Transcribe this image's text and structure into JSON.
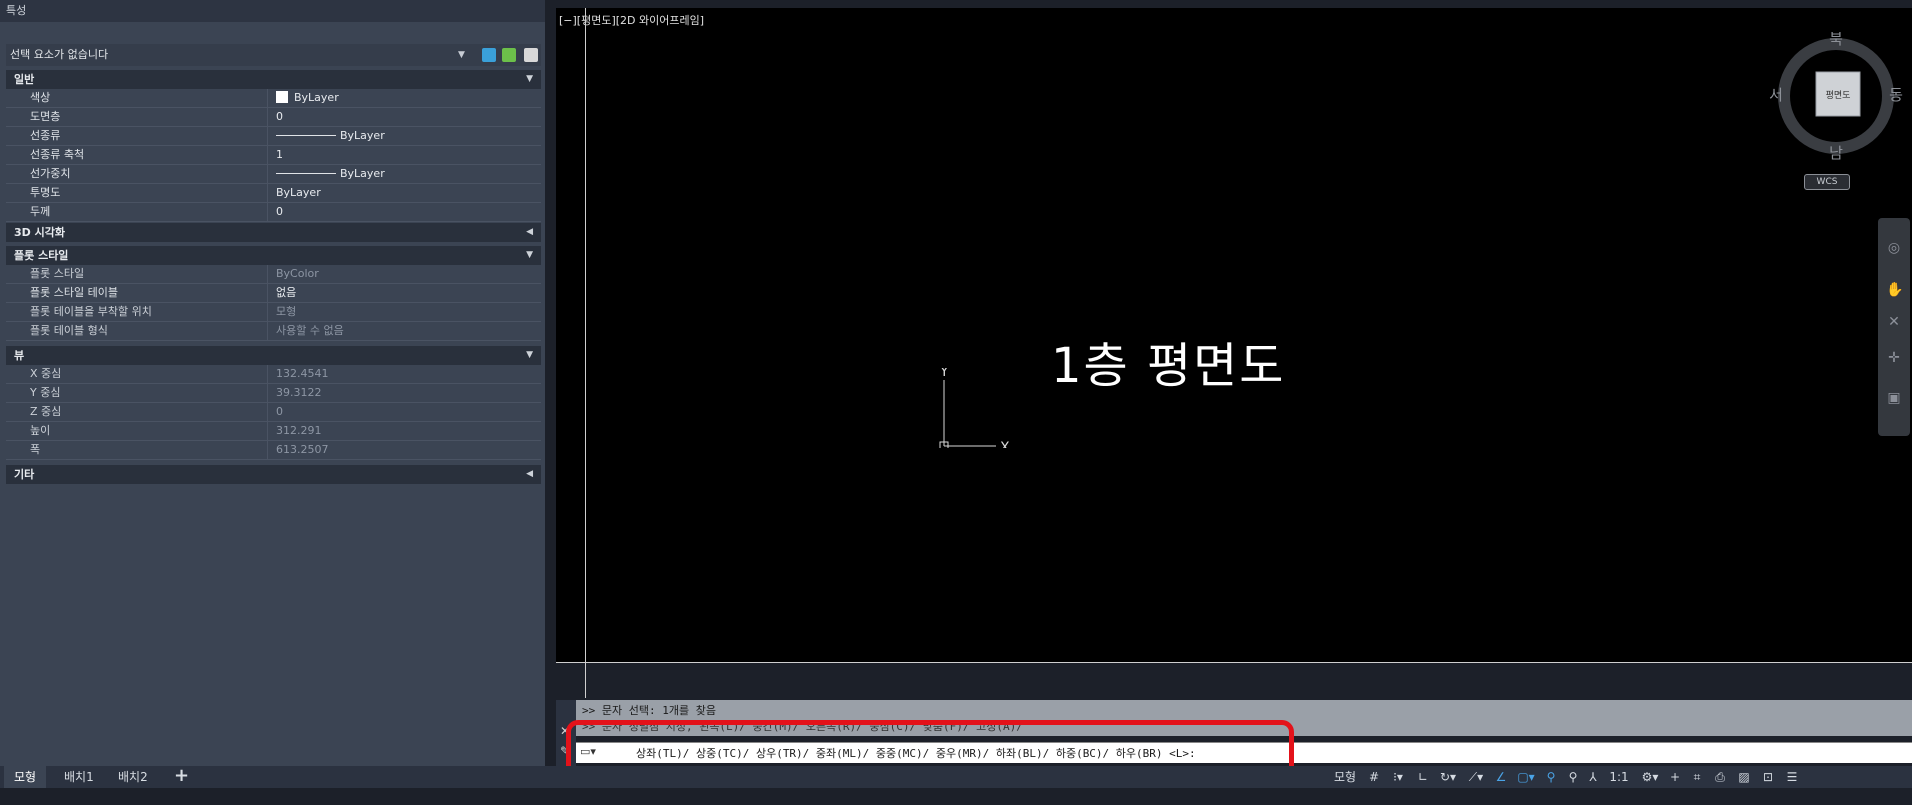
{
  "palette": {
    "title": "특성",
    "selection": "선택 요소가 없습니다",
    "sections": {
      "general": "일반",
      "viz3d": "3D 시각화",
      "plotstyle": "플롯 스타일",
      "view": "뷰",
      "misc": "기타"
    },
    "general_rows": [
      {
        "label": "색상",
        "value": "ByLayer"
      },
      {
        "label": "도면층",
        "value": "0"
      },
      {
        "label": "선종류",
        "value": "ByLayer"
      },
      {
        "label": "선종류 축척",
        "value": "1"
      },
      {
        "label": "선가중치",
        "value": "ByLayer"
      },
      {
        "label": "투명도",
        "value": "ByLayer"
      },
      {
        "label": "두께",
        "value": "0"
      }
    ],
    "plot_rows": [
      {
        "label": "플롯 스타일",
        "value": "ByColor"
      },
      {
        "label": "플롯 스타일 테이블",
        "value": "없음"
      },
      {
        "label": "플롯 테이블을 부착할 위치",
        "value": "모형"
      },
      {
        "label": "플롯 테이블 형식",
        "value": "사용할 수 없음"
      }
    ],
    "view_rows": [
      {
        "label": "X 중심",
        "value": "132.4541"
      },
      {
        "label": "Y 중심",
        "value": "39.3122"
      },
      {
        "label": "Z 중심",
        "value": "0"
      },
      {
        "label": "높이",
        "value": "312.291"
      },
      {
        "label": "폭",
        "value": "613.2507"
      }
    ]
  },
  "tabs": {
    "model": "모형",
    "layout1": "배치1",
    "layout2": "배치2",
    "add": "+"
  },
  "viewport": {
    "label": "[−][평면도][2D 와이어프레임]",
    "text": "1층 평면도",
    "ucs_x": "X",
    "ucs_y": "Y",
    "viewcube": {
      "north": "북",
      "south": "남",
      "east": "동",
      "west": "서",
      "face": "평면도",
      "wcs": "WCS"
    }
  },
  "command": {
    "history1": ">> 문자 선택: 1개를 찾음",
    "history2": ">> 문자 정렬점 지정, 왼쪽(L)/ 중간(M)/ 오른쪽(R)/ 중심(C)/ 맞춤(F)/ 고정(A)/",
    "prompt": "상좌(TL)/ 상중(TC)/ 상우(TR)/ 중좌(ML)/ 중중(MC)/ 중우(MR)/ 하좌(BL)/ 하중(BC)/ 하우(BR) <L>:"
  },
  "status": {
    "model": "모형",
    "scale": "1:1"
  },
  "colors": {
    "accent": "#4aa3e6",
    "highlight": "#e3121a",
    "panel": "#3b4453"
  }
}
